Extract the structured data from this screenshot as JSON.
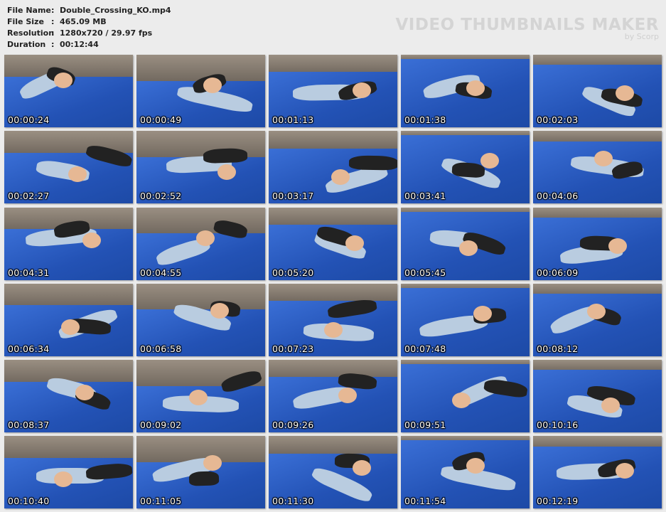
{
  "info": [
    {
      "key": "File Name",
      "value": "Double_Crossing_KO.mp4"
    },
    {
      "key": "File Size",
      "value": "465.09 MB"
    },
    {
      "key": "Resolution",
      "value": "1280x720 / 29.97 fps"
    },
    {
      "key": "Duration",
      "value": "00:12:44"
    }
  ],
  "brand": {
    "title": "VIDEO THUMBNAILS MAKER",
    "by": "by Scorp"
  },
  "separator": ":",
  "thumbnails": [
    "00:00:24",
    "00:00:49",
    "00:01:13",
    "00:01:38",
    "00:02:03",
    "00:02:27",
    "00:02:52",
    "00:03:17",
    "00:03:41",
    "00:04:06",
    "00:04:31",
    "00:04:55",
    "00:05:20",
    "00:05:45",
    "00:06:09",
    "00:06:34",
    "00:06:58",
    "00:07:23",
    "00:07:48",
    "00:08:12",
    "00:08:37",
    "00:09:02",
    "00:09:26",
    "00:09:51",
    "00:10:16",
    "00:10:40",
    "00:11:05",
    "00:11:30",
    "00:11:54",
    "00:12:19"
  ]
}
